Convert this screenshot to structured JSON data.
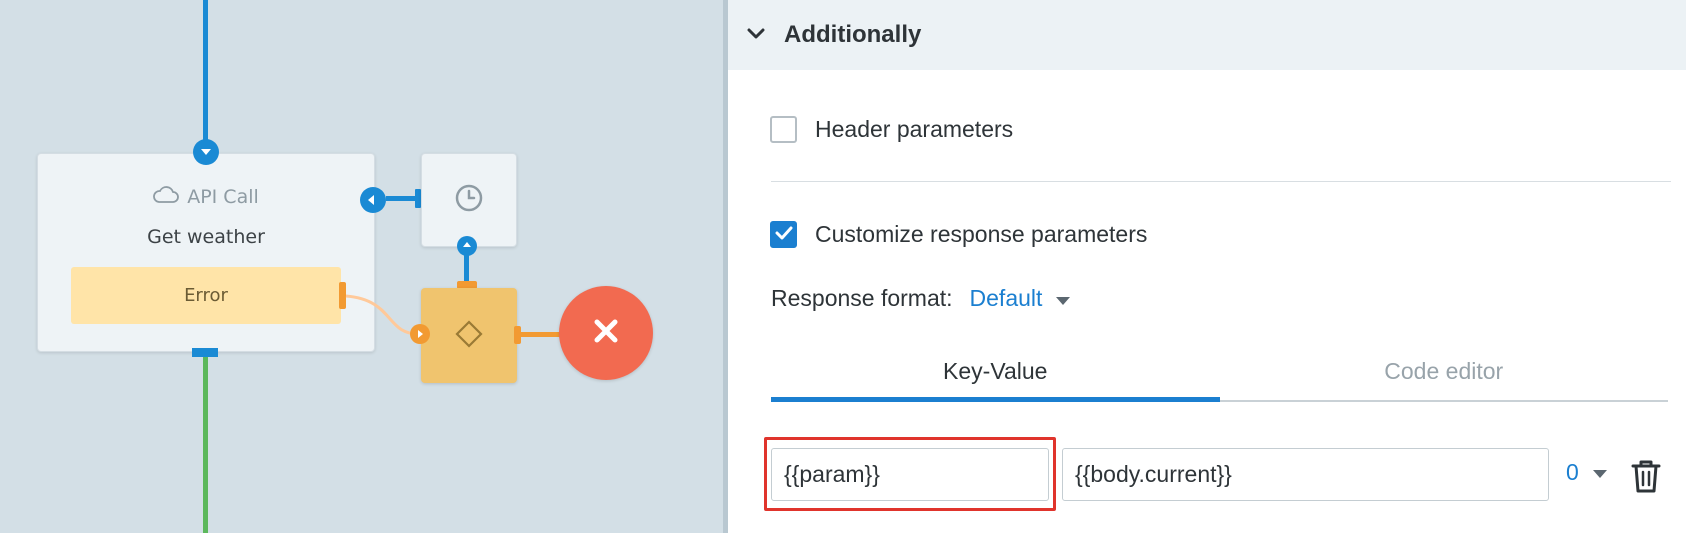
{
  "canvas": {
    "api_node": {
      "type_label": "API Call",
      "type_icon": "cloud-icon",
      "title": "Get weather",
      "error_label": "Error"
    },
    "timer_node": {
      "icon": "clock-icon"
    },
    "condition_node": {
      "icon": "diamond-icon"
    },
    "stop_node": {
      "icon": "close-icon"
    },
    "colors": {
      "flow_blue": "#1a8ad4",
      "flow_green": "#5cb85c",
      "error_orange": "#f29a32",
      "stop_red": "#f26a50"
    }
  },
  "panel": {
    "section": {
      "title": "Additionally",
      "expanded": true,
      "icon": "chevron-down-icon"
    },
    "header_parameters": {
      "label": "Header parameters",
      "checked": false
    },
    "customize_response": {
      "label": "Customize response parameters",
      "checked": true
    },
    "response_format": {
      "label": "Response format:",
      "value": "Default"
    },
    "tabs": [
      {
        "label": "Key-Value",
        "active": true
      },
      {
        "label": "Code editor",
        "active": false
      }
    ],
    "kv_row": {
      "key": "{{param}}",
      "value": "{{body.current}}",
      "count": "0",
      "delete_icon": "trash-icon"
    },
    "accent_color": "#1b7fd0",
    "highlight_color": "#e0342c"
  }
}
